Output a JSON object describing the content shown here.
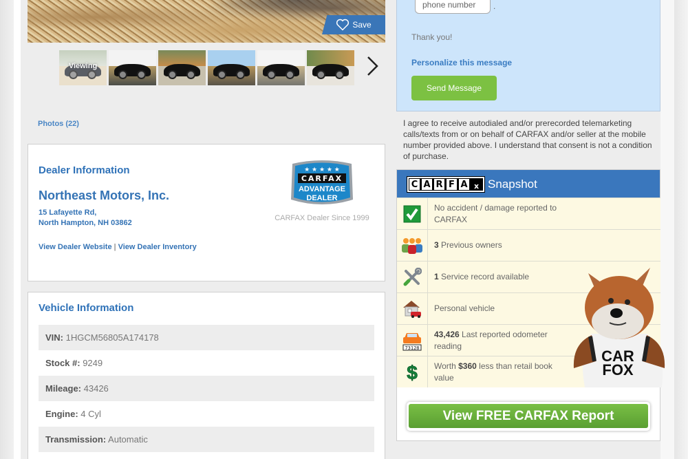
{
  "gallery": {
    "save_label": "Save",
    "viewing_label": "Viewing",
    "thumbnail_count": 6,
    "photos_link": "Photos (22)"
  },
  "dealer": {
    "section_title": "Dealer Information",
    "name": "Northeast Motors, Inc.",
    "address_line1": "15 Lafayette Rd,",
    "address_line2": "North Hampton, NH 03862",
    "website_link": "View Dealer Website",
    "separator": "|",
    "inventory_link": "View Dealer Inventory",
    "badge": {
      "brand": "CARFAX",
      "line1": "ADVANTAGE",
      "line2": "DEALER"
    },
    "since_text": "CARFAX Dealer Since 1999"
  },
  "vehicle": {
    "section_title": "Vehicle Information",
    "rows": [
      {
        "label": "VIN:",
        "value": "1HGCM56805A174178"
      },
      {
        "label": "Stock #:",
        "value": "9249"
      },
      {
        "label": "Mileage:",
        "value": "43426"
      },
      {
        "label": "Engine:",
        "value": "4 Cyl"
      },
      {
        "label": "Transmission:",
        "value": "Automatic"
      }
    ]
  },
  "message": {
    "phone_placeholder": "phone number",
    "period": ".",
    "thanks": "Thank you!",
    "personalize_link": "Personalize this message",
    "send_button": "Send Message",
    "consent": "I agree to receive autodialed and/or prerecorded telemarketing calls/texts from or on behalf of CARFAX and/or seller at the mobile number provided above. I understand that consent is not a condition of purchase."
  },
  "snapshot": {
    "logo_letters": [
      "C",
      "A",
      "R",
      "F",
      "A",
      "x"
    ],
    "title": "Snapshot",
    "rows": [
      {
        "icon": "checkmark-icon",
        "bold": "",
        "text": "No accident / damage reported to CARFAX"
      },
      {
        "icon": "owners-icon",
        "bold": "3",
        "text": " Previous owners"
      },
      {
        "icon": "tools-icon",
        "bold": "1",
        "text": " Service record available"
      },
      {
        "icon": "house-car-icon",
        "bold": "",
        "text": "Personal vehicle"
      },
      {
        "icon": "odometer-car-icon",
        "bold": "43,426",
        "text": " Last reported odometer reading"
      },
      {
        "icon": "dollar-icon",
        "pre": "Worth ",
        "bold": "$360",
        "text": " less than retail book value"
      }
    ],
    "odometer_digits": "73128",
    "mascot_shirt_line1": "CAR",
    "mascot_shirt_line2": "FOX",
    "report_button": "View FREE CARFAX Report"
  },
  "colors": {
    "brand_blue": "#3a77bd",
    "link_blue": "#3473b5",
    "action_green": "#7cc142",
    "message_bg": "#cde5fb",
    "snapshot_row_bg": "#fdf9e2"
  }
}
